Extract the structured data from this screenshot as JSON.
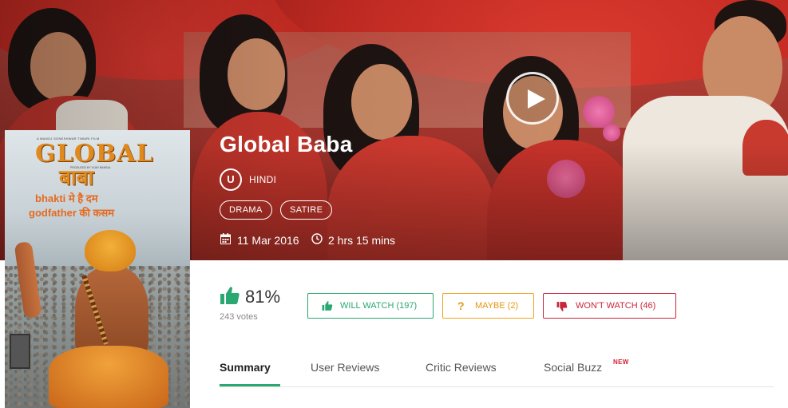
{
  "movie": {
    "title": "Global Baba",
    "language_icon_letter": "U",
    "language": "HINDI",
    "genres": [
      "DRAMA",
      "SATIRE"
    ],
    "release_date": "11 Mar 2016",
    "duration": "2 hrs 15 mins"
  },
  "poster": {
    "credit_line": "A MANOJ SONESHWAR TIWARI FILM",
    "producer_line": "PRODUCED BY VIJAY BANSAL",
    "title_line1": "GLOBAL",
    "title_line2": "बाबा",
    "tagline1": "bhakti मे है दम",
    "tagline2": "godfather की कसम"
  },
  "rating": {
    "percent": "81%",
    "votes": "243 votes"
  },
  "actions": {
    "will_watch": "WILL WATCH (197)",
    "maybe_icon": "?",
    "maybe": "MAYBE (2)",
    "wont_watch": "WON'T WATCH (46)"
  },
  "tabs": {
    "items": [
      "Summary",
      "User Reviews",
      "Critic Reviews",
      "Social Buzz"
    ],
    "new_badge": "NEW",
    "active": "Summary"
  },
  "icons": {
    "play": "play-icon",
    "calendar": "calendar-icon",
    "clock": "clock-icon",
    "thumbs_up": "thumbs-up-icon",
    "thumbs_down": "thumbs-down-icon"
  },
  "colors": {
    "accent_green": "#2aa871",
    "maybe_orange": "#f0a21b",
    "wont_red": "#c8263a",
    "new_badge_red": "#d4202f"
  }
}
